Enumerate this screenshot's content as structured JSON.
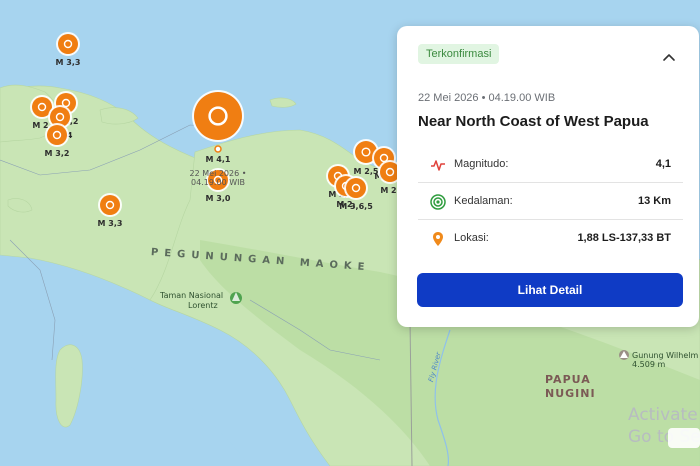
{
  "map": {
    "markers": [
      {
        "label": "M 3,3"
      },
      {
        "label": "M 2,"
      },
      {
        "label": "M 2,2"
      },
      {
        "label": "M 2,4"
      },
      {
        "label": "M 3,2"
      },
      {
        "label": "M 3,3"
      },
      {
        "label": "M 4,1"
      },
      {
        "label": "M 3,0"
      },
      {
        "label": "M 2,5"
      },
      {
        "label": "M 2,"
      },
      {
        "label": "M 2,"
      },
      {
        "label": "M 2,"
      },
      {
        "label": "M 3,6,5"
      },
      {
        "label": "M 2,"
      }
    ],
    "selected_time_line1": "22 Mei 2026 •",
    "selected_time_line2": "04.19.00 WIB",
    "places": {
      "park_line1": "Taman Nasional",
      "park_line2": "Lorentz",
      "mountain_range": "PEGUNUNGAN MAOKE",
      "range_fragment": "MA",
      "country_line1": "PAPUA",
      "country_line2": "NUGINI",
      "peak_name": "Gunung Wilhelm",
      "peak_height": "4.509 m",
      "river": "Fly River"
    },
    "watermark_line1": "Activate",
    "watermark_line2": "Go to Se"
  },
  "card": {
    "status_badge": "Terkonfirmasi",
    "datetime": "22 Mei 2026 • 04.19.00 WIB",
    "title": "Near North Coast of West Papua",
    "rows": [
      {
        "label": "Magnitudo:",
        "value": "4,1",
        "icon": "pulse-icon"
      },
      {
        "label": "Kedalaman:",
        "value": "13 Km",
        "icon": "target-icon"
      },
      {
        "label": "Lokasi:",
        "value": "1,88 LS-137,33 BT",
        "icon": "location-pin-icon"
      }
    ],
    "detail_button": "Lihat Detail"
  },
  "colors": {
    "sea": "#a7d4ef",
    "land": "#c9e5b5",
    "marker": "#f07e12",
    "badge_bg": "#e1f5e2",
    "badge_text": "#3b8a3f",
    "button": "#0f3bc5"
  }
}
